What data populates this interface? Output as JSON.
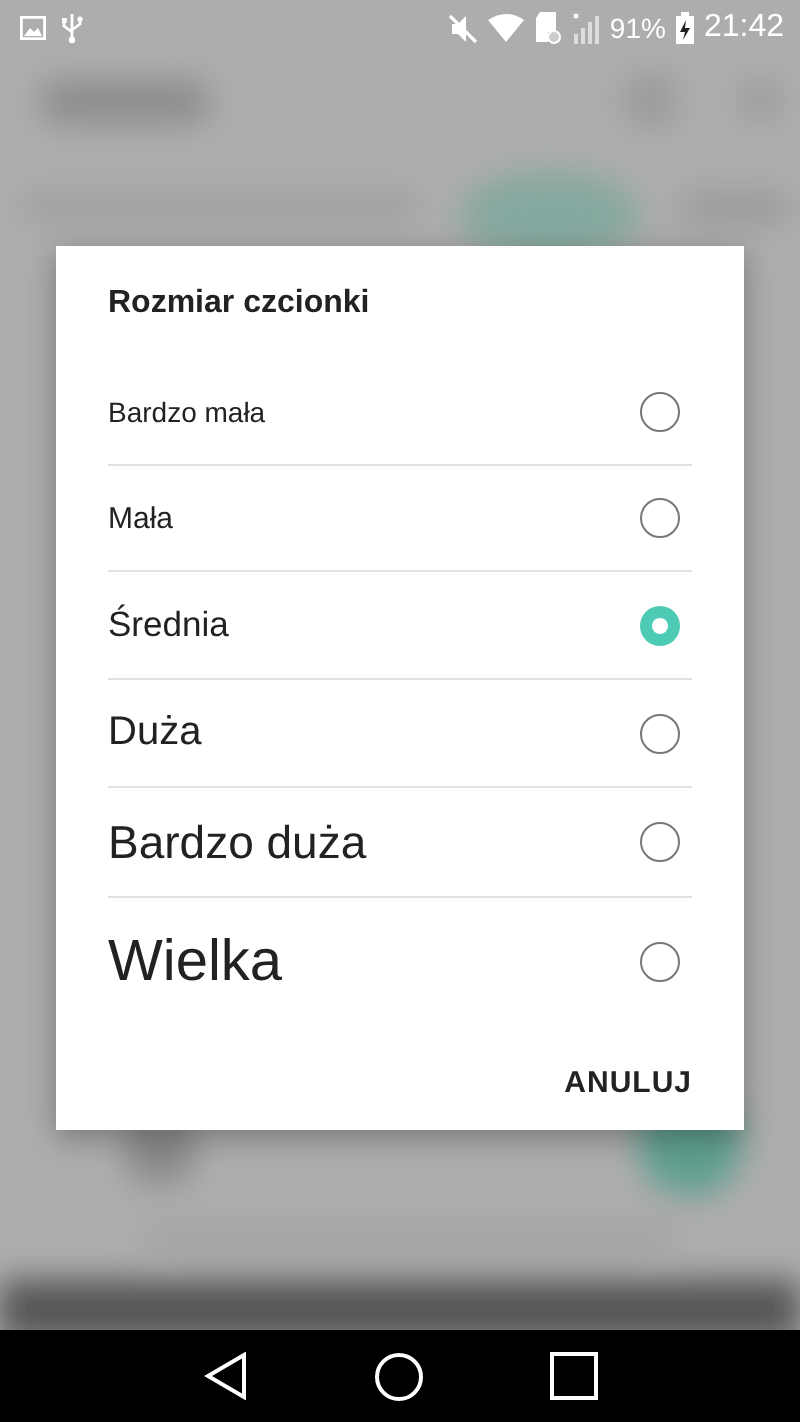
{
  "status_bar": {
    "battery": "91%",
    "time": "21:42"
  },
  "dialog": {
    "title": "Rozmiar czcionki",
    "options": [
      {
        "label": "Bardzo mała",
        "selected": false
      },
      {
        "label": "Mała",
        "selected": false
      },
      {
        "label": "Średnia",
        "selected": true
      },
      {
        "label": "Duża",
        "selected": false
      },
      {
        "label": "Bardzo duża",
        "selected": false
      },
      {
        "label": "Wielka",
        "selected": false
      }
    ],
    "buttons": [
      "ANULUJ"
    ]
  }
}
